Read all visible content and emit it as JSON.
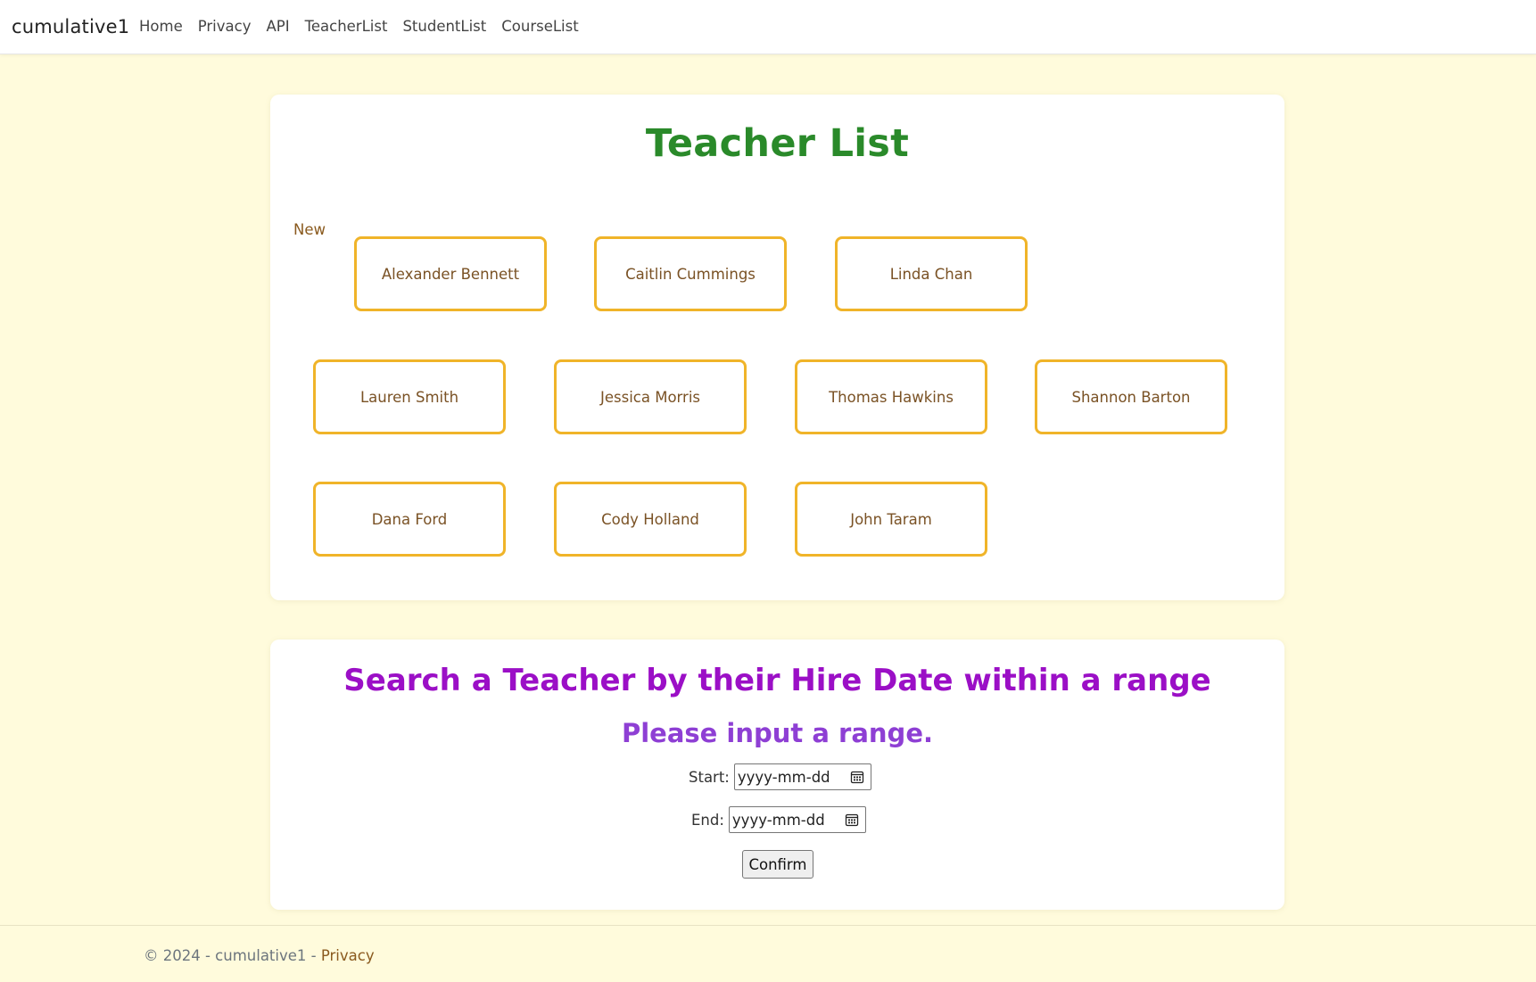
{
  "navbar": {
    "brand": "cumulative1",
    "links": [
      "Home",
      "Privacy",
      "API",
      "TeacherList",
      "StudentList",
      "CourseList"
    ]
  },
  "teacher_list": {
    "title": "Teacher List",
    "new_label": "New",
    "teachers": [
      "Alexander Bennett",
      "Caitlin Cummings",
      "Linda Chan",
      "Lauren Smith",
      "Jessica Morris",
      "Thomas Hawkins",
      "Shannon Barton",
      "Dana Ford",
      "Cody Holland",
      "John Taram"
    ]
  },
  "search": {
    "title": "Search a Teacher by their Hire Date within a range",
    "subtitle": "Please input a range.",
    "start_label": "Start:",
    "start_placeholder": "yyyy-mm-dd",
    "end_label": "End:",
    "end_placeholder": "yyyy-mm-dd",
    "confirm_label": "Confirm"
  },
  "footer": {
    "text": "© 2024 - cumulative1 - ",
    "privacy_link": "Privacy"
  },
  "colors": {
    "page_background": "#fffbdc",
    "teacher_list_title": "#2a8a2a",
    "teacher_card_border": "#f0b429",
    "search_title": "#9b0fc6",
    "search_subtitle": "#8e3fd4",
    "link_brown": "#8a5a1e"
  },
  "icons": {
    "date_picker": "calendar-icon"
  }
}
